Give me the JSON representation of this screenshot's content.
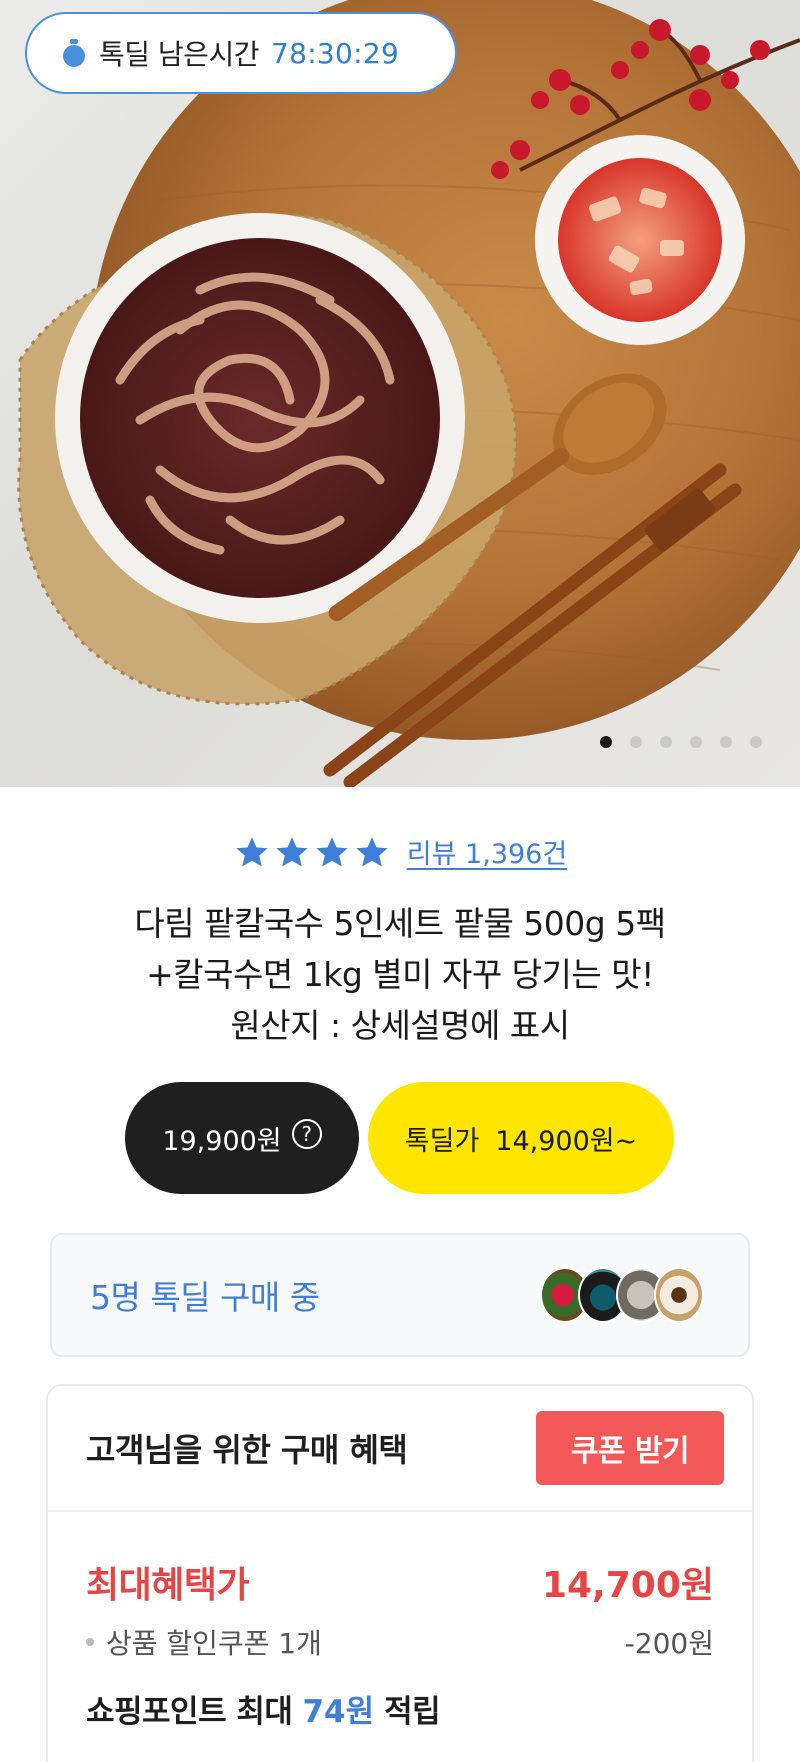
{
  "timer": {
    "label": "톡딜 남은시간",
    "value": "78:30:29",
    "icon": "stopwatch-icon"
  },
  "gallery": {
    "image": "red-bean-kalguksu-photo",
    "slide_count": 6,
    "active_slide": 1
  },
  "rating": {
    "stars": 4,
    "review_text": "리뷰 1,396건"
  },
  "product": {
    "title_line1": "다림 팥칼국수 5인세트 팥물 500g 5팩",
    "title_line2": "+칼국수면 1kg 별미 자꾸 당기는 맛!",
    "title_line3": "원산지 : 상세설명에 표시"
  },
  "price": {
    "original": "19,900원",
    "help_glyph": "?",
    "deal_label": "톡딜가",
    "deal_value": "14,900원~"
  },
  "buyers": {
    "text": "5명 톡딜 구매 중"
  },
  "benefit": {
    "title": "고객님을 위한 구매 혜택",
    "coupon_button": "쿠폰 받기",
    "max_label": "최대혜택가",
    "max_value": "14,700원",
    "coupon_label": "상품 할인쿠폰 1개",
    "coupon_value": "-200원",
    "points_prefix": "쇼핑포인트 최대",
    "points_amount": "74원",
    "points_suffix": "적립"
  },
  "colors": {
    "accent_blue": "#3f7fd8",
    "deal_yellow": "#ffe600",
    "price_red": "#e64545",
    "coupon_button_red": "#f25858",
    "dark_pill": "#1f1f1f"
  }
}
